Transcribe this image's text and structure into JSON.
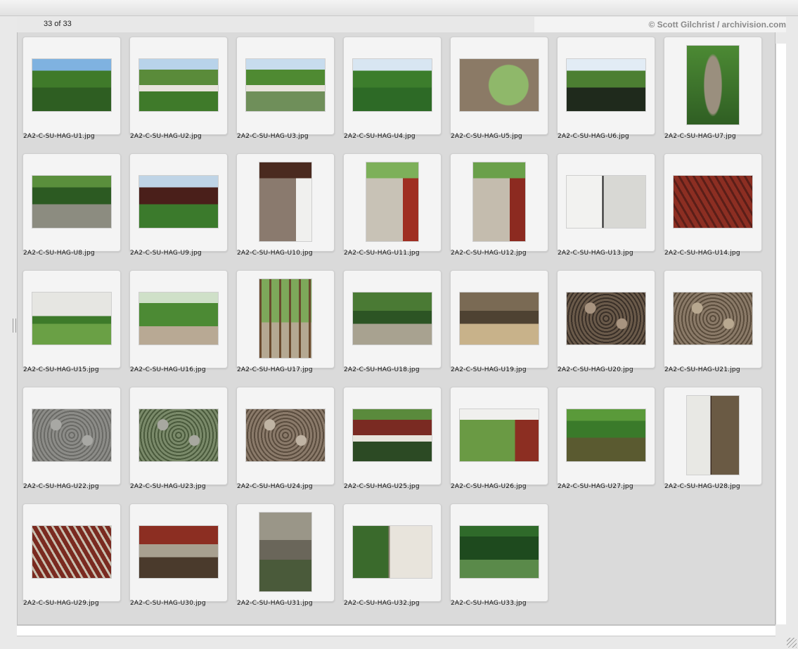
{
  "header": {
    "count_text": "33 of 33",
    "credit_text": "© Scott Gilchrist / archivision.com"
  },
  "thumbnails": [
    {
      "filename": "2A2-C-SU-HAG-U1.jpg",
      "orientation": "land",
      "scene": "pond",
      "colors": [
        "#7fb2e0",
        "#3f7a2a",
        "#2e5e22"
      ]
    },
    {
      "filename": "2A2-C-SU-HAG-U2.jpg",
      "orientation": "land",
      "scene": "pavilion",
      "colors": [
        "#b8d3ea",
        "#5a8b3a",
        "#3f7a2a"
      ]
    },
    {
      "filename": "2A2-C-SU-HAG-U3.jpg",
      "orientation": "land",
      "scene": "pavilion",
      "colors": [
        "#c7dcee",
        "#4f8a32",
        "#6f8f5a"
      ]
    },
    {
      "filename": "2A2-C-SU-HAG-U4.jpg",
      "orientation": "land",
      "scene": "pond",
      "colors": [
        "#d8e6f2",
        "#3c7d2c",
        "#2d6a26"
      ]
    },
    {
      "filename": "2A2-C-SU-HAG-U5.jpg",
      "orientation": "land",
      "scene": "moongate",
      "colors": [
        "#8b7a66",
        "#5b4e42",
        "#8fb86a"
      ]
    },
    {
      "filename": "2A2-C-SU-HAG-U6.jpg",
      "orientation": "land",
      "scene": "pond",
      "colors": [
        "#e2ecf5",
        "#4c7f32",
        "#1f2a1c"
      ]
    },
    {
      "filename": "2A2-C-SU-HAG-U7.jpg",
      "orientation": "port",
      "scene": "lantern",
      "colors": [
        "#4c8a34",
        "#2f5e23",
        "#9a8f7e"
      ]
    },
    {
      "filename": "2A2-C-SU-HAG-U8.jpg",
      "orientation": "land",
      "scene": "pond",
      "colors": [
        "#5a8f3c",
        "#2c5a22",
        "#8c8c80"
      ]
    },
    {
      "filename": "2A2-C-SU-HAG-U9.jpg",
      "orientation": "land",
      "scene": "pond",
      "colors": [
        "#bfd4e6",
        "#4a1f1a",
        "#3b7a2c"
      ]
    },
    {
      "filename": "2A2-C-SU-HAG-U10.jpg",
      "orientation": "port",
      "scene": "corridor",
      "colors": [
        "#f0f0ee",
        "#4a2a1f",
        "#8a7a6e"
      ]
    },
    {
      "filename": "2A2-C-SU-HAG-U11.jpg",
      "orientation": "port",
      "scene": "corridor",
      "colors": [
        "#9f2e22",
        "#7db05a",
        "#c8c2b6"
      ]
    },
    {
      "filename": "2A2-C-SU-HAG-U12.jpg",
      "orientation": "port",
      "scene": "corridor",
      "colors": [
        "#8c2a20",
        "#6aa04a",
        "#c4bcae"
      ]
    },
    {
      "filename": "2A2-C-SU-HAG-U13.jpg",
      "orientation": "land",
      "scene": "wall",
      "colors": [
        "#f2f2f0",
        "#d8d8d4",
        "#222222"
      ]
    },
    {
      "filename": "2A2-C-SU-HAG-U14.jpg",
      "orientation": "land",
      "scene": "roof",
      "colors": [
        "#8c2e22",
        "#5a1e18",
        "#e8e8e8"
      ]
    },
    {
      "filename": "2A2-C-SU-HAG-U15.jpg",
      "orientation": "land",
      "scene": "lawn",
      "colors": [
        "#e6e6e2",
        "#3d7a2a",
        "#6aa045"
      ]
    },
    {
      "filename": "2A2-C-SU-HAG-U16.jpg",
      "orientation": "land",
      "scene": "trees",
      "colors": [
        "#cfe0c8",
        "#4c8a34",
        "#b8a994"
      ]
    },
    {
      "filename": "2A2-C-SU-HAG-U17.jpg",
      "orientation": "port",
      "scene": "pergola",
      "colors": [
        "#6a4a2e",
        "#7da85a",
        "#b4a892"
      ]
    },
    {
      "filename": "2A2-C-SU-HAG-U18.jpg",
      "orientation": "land",
      "scene": "rockery",
      "colors": [
        "#4a7a34",
        "#2c5424",
        "#a8a290"
      ]
    },
    {
      "filename": "2A2-C-SU-HAG-U19.jpg",
      "orientation": "land",
      "scene": "rockery",
      "colors": [
        "#7a6a54",
        "#4e4232",
        "#c8b28a"
      ]
    },
    {
      "filename": "2A2-C-SU-HAG-U20.jpg",
      "orientation": "land",
      "scene": "paving",
      "colors": [
        "#6a5a4a",
        "#3a3028",
        "#a89480"
      ]
    },
    {
      "filename": "2A2-C-SU-HAG-U21.jpg",
      "orientation": "land",
      "scene": "paving",
      "colors": [
        "#8a7a68",
        "#5a4c3c",
        "#b8a890"
      ]
    },
    {
      "filename": "2A2-C-SU-HAG-U22.jpg",
      "orientation": "land",
      "scene": "paving",
      "colors": [
        "#8c8c88",
        "#6a6a66",
        "#a8a8a4"
      ]
    },
    {
      "filename": "2A2-C-SU-HAG-U23.jpg",
      "orientation": "land",
      "scene": "paving",
      "colors": [
        "#7a8a6a",
        "#4a5a3c",
        "#a8a8a0"
      ]
    },
    {
      "filename": "2A2-C-SU-HAG-U24.jpg",
      "orientation": "land",
      "scene": "paving",
      "colors": [
        "#8a7a6a",
        "#5a4c3e",
        "#c0b4a4"
      ]
    },
    {
      "filename": "2A2-C-SU-HAG-U25.jpg",
      "orientation": "land",
      "scene": "pavilion",
      "colors": [
        "#5a8a3c",
        "#7a2a22",
        "#2c4a24"
      ]
    },
    {
      "filename": "2A2-C-SU-HAG-U26.jpg",
      "orientation": "land",
      "scene": "corridor",
      "colors": [
        "#8c2e22",
        "#f0f0ee",
        "#6a9a44"
      ]
    },
    {
      "filename": "2A2-C-SU-HAG-U27.jpg",
      "orientation": "land",
      "scene": "pond",
      "colors": [
        "#5a9a3a",
        "#3a7a2a",
        "#5a5a30"
      ]
    },
    {
      "filename": "2A2-C-SU-HAG-U28.jpg",
      "orientation": "port",
      "scene": "wall",
      "colors": [
        "#e8e8e4",
        "#6a5a44",
        "#3a2a22"
      ]
    },
    {
      "filename": "2A2-C-SU-HAG-U29.jpg",
      "orientation": "land",
      "scene": "roof",
      "colors": [
        "#7a2a20",
        "#c8c0b0",
        "#4a1e18"
      ]
    },
    {
      "filename": "2A2-C-SU-HAG-U30.jpg",
      "orientation": "land",
      "scene": "rockery",
      "colors": [
        "#8c2e22",
        "#a8a090",
        "#4a3a2c"
      ]
    },
    {
      "filename": "2A2-C-SU-HAG-U31.jpg",
      "orientation": "port",
      "scene": "rockery",
      "colors": [
        "#9a9688",
        "#6a665a",
        "#4a5a3a"
      ]
    },
    {
      "filename": "2A2-C-SU-HAG-U32.jpg",
      "orientation": "land",
      "scene": "wall",
      "colors": [
        "#3a6a2c",
        "#e8e4dc",
        "#8a8070"
      ]
    },
    {
      "filename": "2A2-C-SU-HAG-U33.jpg",
      "orientation": "land",
      "scene": "trees",
      "colors": [
        "#2f6a2a",
        "#1e4a1e",
        "#5a8a4a"
      ]
    }
  ]
}
